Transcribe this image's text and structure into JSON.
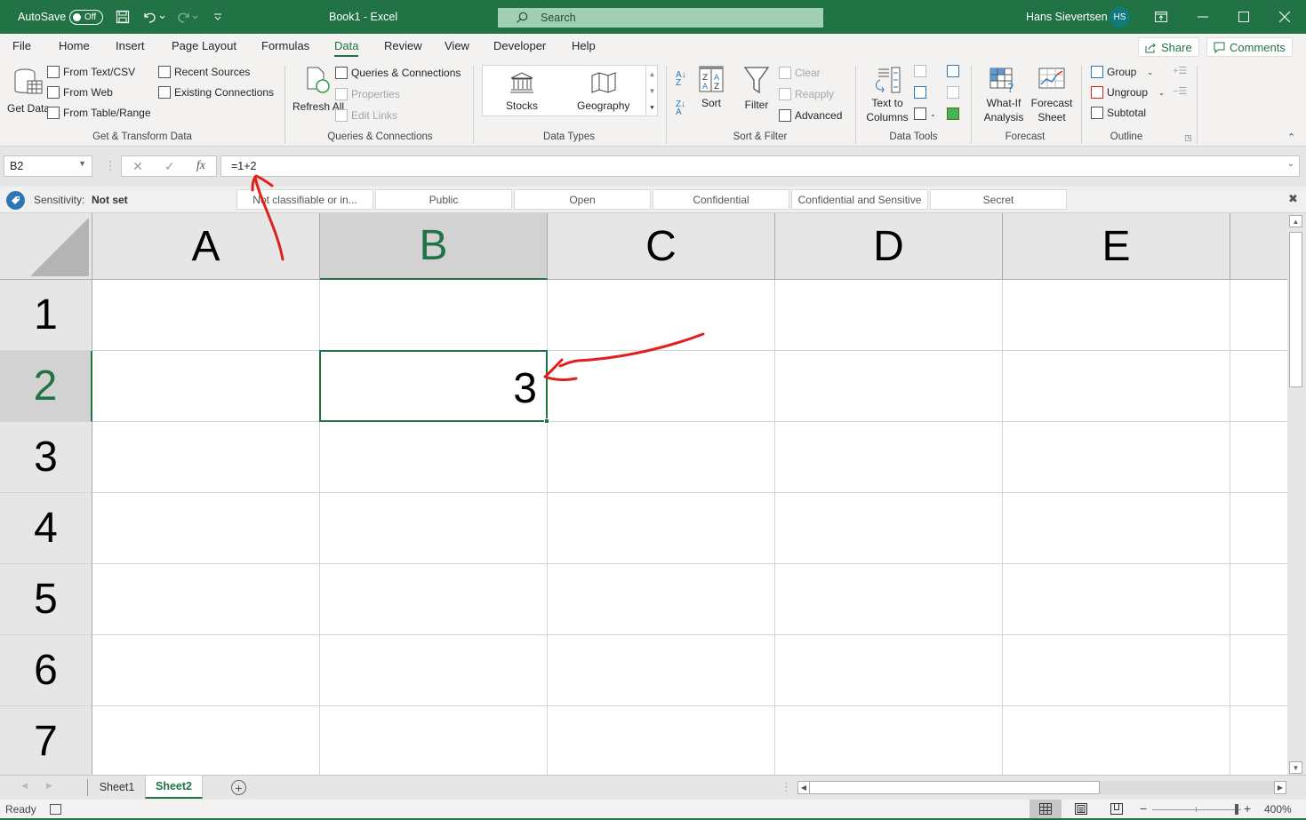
{
  "titlebar": {
    "autosave_label": "AutoSave",
    "autosave_state": "Off",
    "title": "Book1  -  Excel",
    "search_placeholder": "Search",
    "user_name": "Hans Sievertsen",
    "user_initials": "HS",
    "icons": [
      "save-icon",
      "undo-icon",
      "redo-icon",
      "customize-qat-icon",
      "ribbon-display-icon",
      "minimize-icon",
      "maximize-icon",
      "close-icon"
    ]
  },
  "menu": {
    "tabs": [
      "File",
      "Home",
      "Insert",
      "Page Layout",
      "Formulas",
      "Data",
      "Review",
      "View",
      "Developer",
      "Help"
    ],
    "active_tab": "Data",
    "share_label": "Share",
    "comments_label": "Comments"
  },
  "ribbon": {
    "get_transform": {
      "label": "Get & Transform Data",
      "get_data": "Get Data",
      "from_text_csv": "From Text/CSV",
      "from_web": "From Web",
      "from_table_range": "From Table/Range",
      "recent_sources": "Recent Sources",
      "existing_connections": "Existing Connections"
    },
    "queries": {
      "label": "Queries & Connections",
      "refresh_all": "Refresh All",
      "queries_connections": "Queries & Connections",
      "properties": "Properties",
      "edit_links": "Edit Links"
    },
    "data_types": {
      "label": "Data Types",
      "stocks": "Stocks",
      "geography": "Geography"
    },
    "sort_filter": {
      "label": "Sort & Filter",
      "sort": "Sort",
      "filter": "Filter",
      "clear": "Clear",
      "reapply": "Reapply",
      "advanced": "Advanced",
      "sort_az": "A→Z",
      "sort_za": "Z→A"
    },
    "data_tools": {
      "label": "Data Tools",
      "text_to_columns": "Text to Columns"
    },
    "forecast": {
      "label": "Forecast",
      "what_if": "What-If Analysis",
      "forecast_sheet": "Forecast Sheet"
    },
    "outline": {
      "label": "Outline",
      "group": "Group",
      "ungroup": "Ungroup",
      "subtotal": "Subtotal"
    }
  },
  "formula_bar": {
    "name_box": "B2",
    "cancel_glyph": "✕",
    "enter_glyph": "✓",
    "fx_glyph": "fx",
    "formula": "=1+2"
  },
  "sensitivity": {
    "label": "Sensitivity:",
    "value": "Not set",
    "options": [
      "Not classifiable or in...",
      "Public",
      "Open",
      "Confidential",
      "Confidential and Sensitive",
      "Secret"
    ]
  },
  "sheet": {
    "columns": [
      "A",
      "B",
      "C",
      "D",
      "E"
    ],
    "rows": [
      "1",
      "2",
      "3",
      "4",
      "5",
      "6",
      "7"
    ],
    "selected_cell": "B2",
    "selected_column": "B",
    "selected_row": "2",
    "cells": {
      "B2": "3"
    }
  },
  "sheet_tabs": {
    "tabs": [
      "Sheet1",
      "Sheet2"
    ],
    "active": "Sheet2"
  },
  "status": {
    "ready": "Ready",
    "zoom": "400%",
    "zoom_slider_fraction": 0.95
  },
  "annotation": {
    "color": "#e0201b"
  }
}
